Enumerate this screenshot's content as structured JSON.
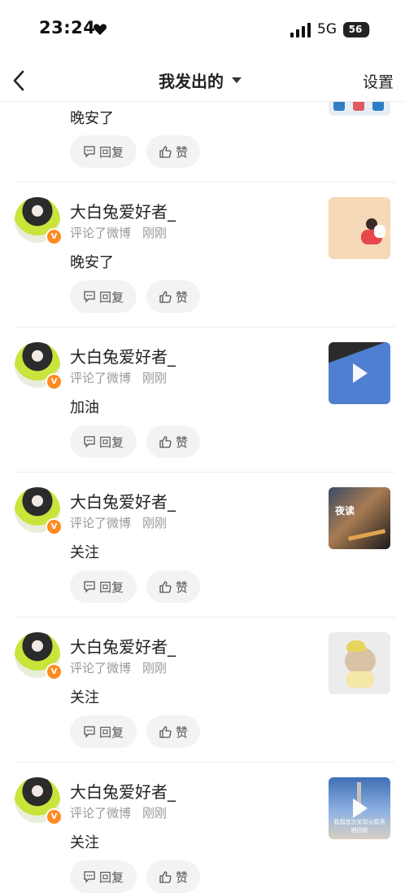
{
  "status_bar": {
    "time": "23:24",
    "network": "5G",
    "battery": "56"
  },
  "nav": {
    "title": "我发出的",
    "settings": "设置"
  },
  "actions": {
    "reply": "回复",
    "like": "赞"
  },
  "items": [
    {
      "username": "",
      "action": "",
      "time": "",
      "comment": "晚安了",
      "thumbnail": "partial-banner"
    },
    {
      "username": "大白兔爱好者_",
      "action": "评论了微博",
      "time": "刚刚",
      "comment": "晚安了",
      "thumbnail": "illustration"
    },
    {
      "username": "大白兔爱好者_",
      "action": "评论了微博",
      "time": "刚刚",
      "comment": "加油",
      "thumbnail": "video"
    },
    {
      "username": "大白兔爱好者_",
      "action": "评论了微博",
      "time": "刚刚",
      "comment": "关注",
      "thumbnail": "image",
      "thumbnail_text": "夜读"
    },
    {
      "username": "大白兔爱好者_",
      "action": "评论了微博",
      "time": "刚刚",
      "comment": "关注",
      "thumbnail": "cat-photo"
    },
    {
      "username": "大白兔爱好者_",
      "action": "评论了微博",
      "time": "刚刚",
      "comment": "关注",
      "thumbnail": "video",
      "thumbnail_text": "我国首次实现火箭落地回收"
    }
  ],
  "icons": [
    "heart-icon",
    "signal-icon",
    "back-icon",
    "caret-down-icon",
    "comment-icon",
    "thumbs-up-icon",
    "play-icon",
    "verified-badge-icon"
  ]
}
